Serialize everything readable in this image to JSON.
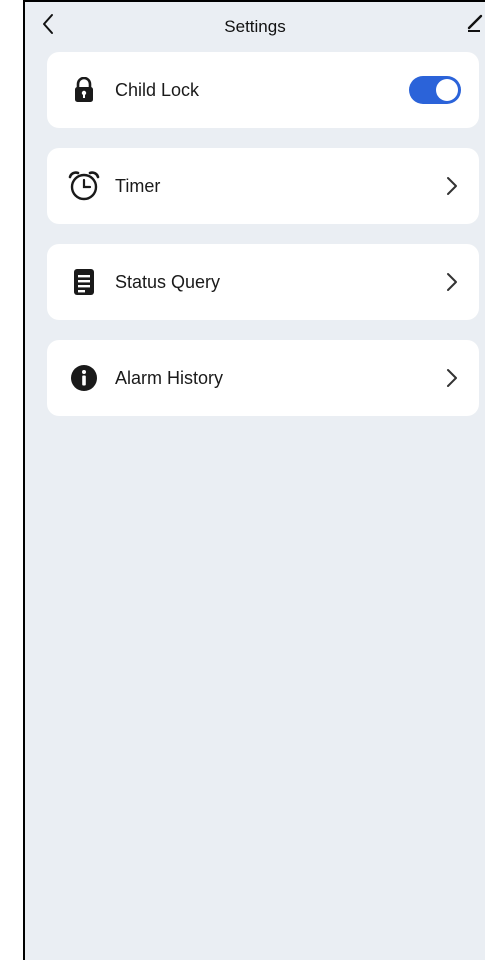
{
  "header": {
    "title": "Settings"
  },
  "items": [
    {
      "label": "Child Lock",
      "icon": "lock-icon",
      "control": "toggle",
      "enabled": true
    },
    {
      "label": "Timer",
      "icon": "alarm-clock-icon",
      "control": "chevron"
    },
    {
      "label": "Status Query",
      "icon": "document-icon",
      "control": "chevron"
    },
    {
      "label": "Alarm History",
      "icon": "info-icon",
      "control": "chevron"
    }
  ],
  "colors": {
    "background": "#eaeef3",
    "card": "#ffffff",
    "accent": "#2b63d9"
  }
}
